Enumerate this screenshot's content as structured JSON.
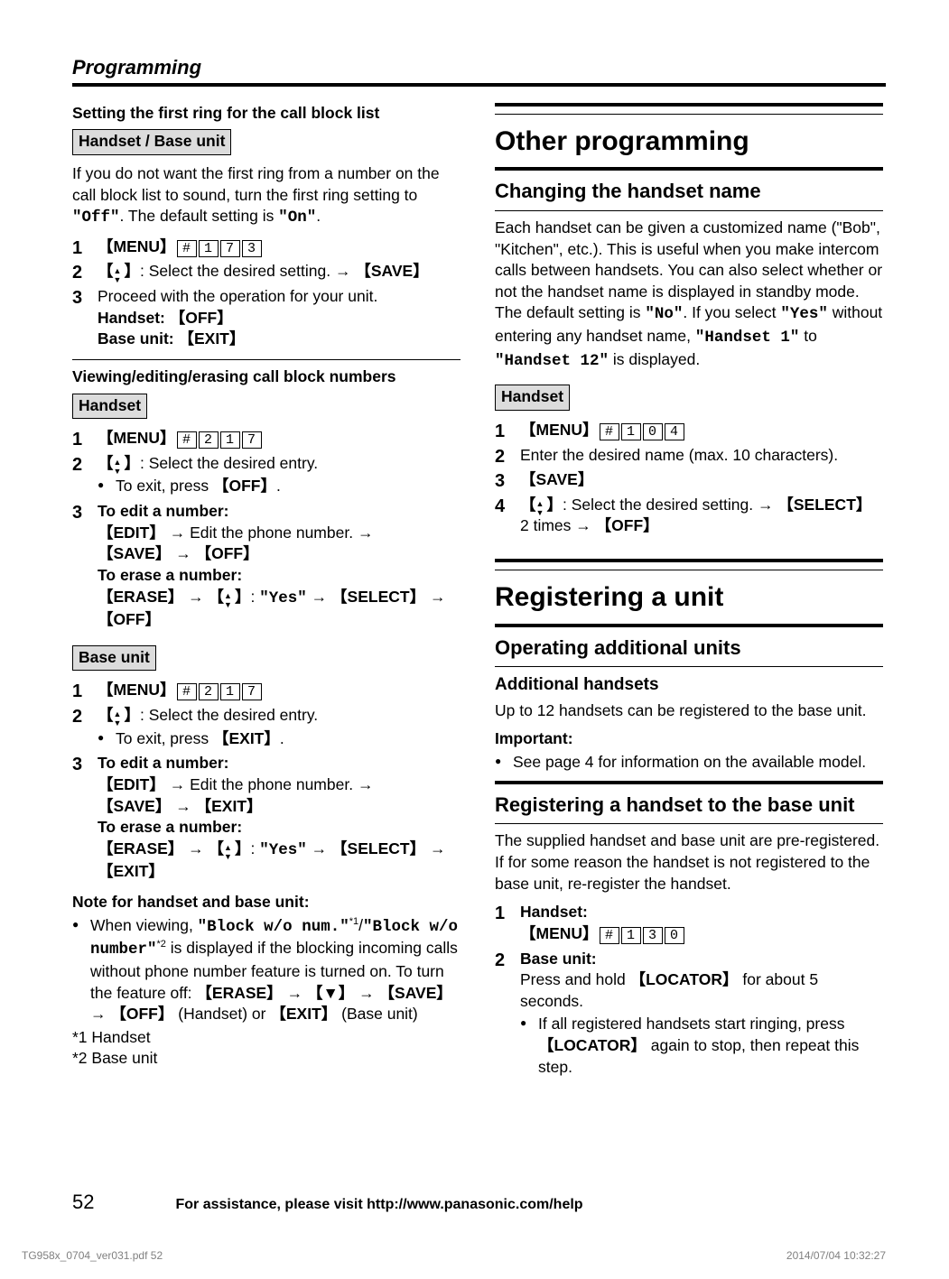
{
  "header": {
    "section": "Programming"
  },
  "left": {
    "s1": {
      "title": "Setting the first ring for the call block list",
      "box": "Handset / Base unit",
      "intro_a": "If you do not want the first ring from a number on the call block list to sound, turn the first ring setting to ",
      "off": "\"Off\"",
      "intro_b": ". The default setting is ",
      "on": "\"On\"",
      "intro_c": ".",
      "step1_menu": "MENU",
      "step1_code": [
        "#",
        "1",
        "7",
        "3"
      ],
      "step2_a": ": Select the desired setting. ",
      "step2_save": "SAVE",
      "step3_a": "Proceed with the operation for your unit.",
      "step3_hs_label": "Handset: ",
      "step3_hs_key": "OFF",
      "step3_bu_label": "Base unit: ",
      "step3_bu_key": "EXIT"
    },
    "s2": {
      "title": "Viewing/editing/erasing call block numbers",
      "box_hs": "Handset",
      "menu": "MENU",
      "code": [
        "#",
        "2",
        "1",
        "7"
      ],
      "step2_a": ": Select the desired entry.",
      "step2_b_pre": "To exit, press ",
      "step2_b_key": "OFF",
      "step3_edit_hd": "To edit a number:",
      "edit_key": "EDIT",
      "edit_mid": " Edit the phone number. ",
      "save_key": "SAVE",
      "off_key": "OFF",
      "step3_erase_hd": "To erase a number:",
      "erase_key": "ERASE",
      "yes": "\"Yes\"",
      "select_key": "SELECT",
      "box_bu": "Base unit",
      "bu_step2_b_key": "EXIT",
      "bu_off_key": "EXIT"
    },
    "note": {
      "title": "Note for handset and base unit:",
      "bullet_a_pre": "When viewing, ",
      "blk1": "\"Block w/o num.\"",
      "sup1": "*1",
      "slash": "/",
      "blk2": "\"Block w/o number\"",
      "sup2": "*2",
      "bullet_a_mid": " is displayed if the blocking incoming calls without phone number feature is turned on. To turn the feature off: ",
      "erase_key": "ERASE",
      "down": "▼",
      "save_key": "SAVE",
      "off_key": "OFF",
      "hs_tag": " (Handset) or ",
      "exit_key": "EXIT",
      "bu_tag": " (Base unit)",
      "fn1": "*1  Handset",
      "fn2": "*2  Base unit"
    }
  },
  "right": {
    "other": {
      "h1": "Other programming",
      "h2": "Changing the handset name",
      "para_a": "Each handset can be given a customized name (\"Bob\", \"Kitchen\", etc.). This is useful when you make intercom calls between handsets. You can also select whether or not the handset name is displayed in standby mode. The default setting is ",
      "no": "\"No\"",
      "para_b": ". If you select ",
      "yes": "\"Yes\"",
      "para_c": " without entering any handset name, ",
      "hs1": "\"Handset 1\"",
      "para_d": " to ",
      "hs12": "\"Handset 12\"",
      "para_e": " is displayed.",
      "box": "Handset",
      "menu": "MENU",
      "code": [
        "#",
        "1",
        "0",
        "4"
      ],
      "step2": "Enter the desired name (max. 10 characters).",
      "save": "SAVE",
      "step4_a": ": Select the desired setting. ",
      "select": "SELECT",
      "step4_b": "2 times ",
      "off": "OFF"
    },
    "reg": {
      "h1": "Registering a unit",
      "h2": "Operating additional units",
      "ah_title": "Additional handsets",
      "ah_para": "Up to 12 handsets can be registered to the base unit.",
      "imp": "Important:",
      "imp_b": "See page 4 for information on the available model.",
      "h2b": "Registering a handset to the base unit",
      "para2": "The supplied handset and base unit are pre-registered. If for some reason the handset is not registered to the base unit, re-register the handset.",
      "s1_label": "Handset:",
      "menu": "MENU",
      "code": [
        "#",
        "1",
        "3",
        "0"
      ],
      "s2_label": "Base unit:",
      "s2_a": "Press and hold ",
      "locator": "LOCATOR",
      "s2_b": " for about 5 seconds.",
      "s2_bullet_a": "If all registered handsets start ringing, press ",
      "s2_bullet_b": " again to stop, then repeat this step."
    }
  },
  "footer": {
    "page": "52",
    "help": "For assistance, please visit http://www.panasonic.com/help"
  },
  "micro": {
    "left": "TG958x_0704_ver031.pdf   52",
    "right": "2014/07/04   10:32:27"
  }
}
